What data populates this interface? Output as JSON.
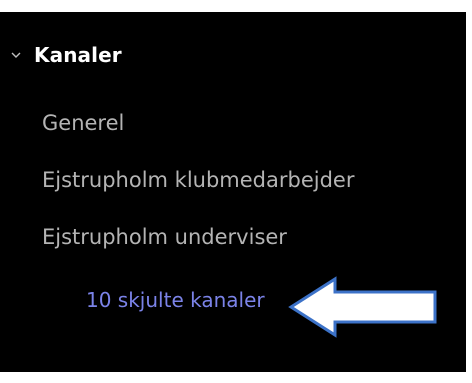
{
  "sidebar": {
    "section": {
      "title": "Kanaler",
      "expanded": true,
      "chevron_icon": "chevron-down-icon"
    },
    "channels": [
      {
        "label": "Generel"
      },
      {
        "label": "Ejstrupholm klubmedarbejder"
      },
      {
        "label": "Ejstrupholm underviser"
      }
    ],
    "hidden_channels_link": {
      "label": "10 skjulte kanaler",
      "color": "#7b83e8"
    }
  },
  "annotation": {
    "icon": "left-arrow-icon",
    "fill": "#ffffff",
    "stroke": "#3c72c8"
  },
  "colors": {
    "background": "#000000",
    "channel_text": "#b4b4b4",
    "header_text": "#ffffff"
  }
}
